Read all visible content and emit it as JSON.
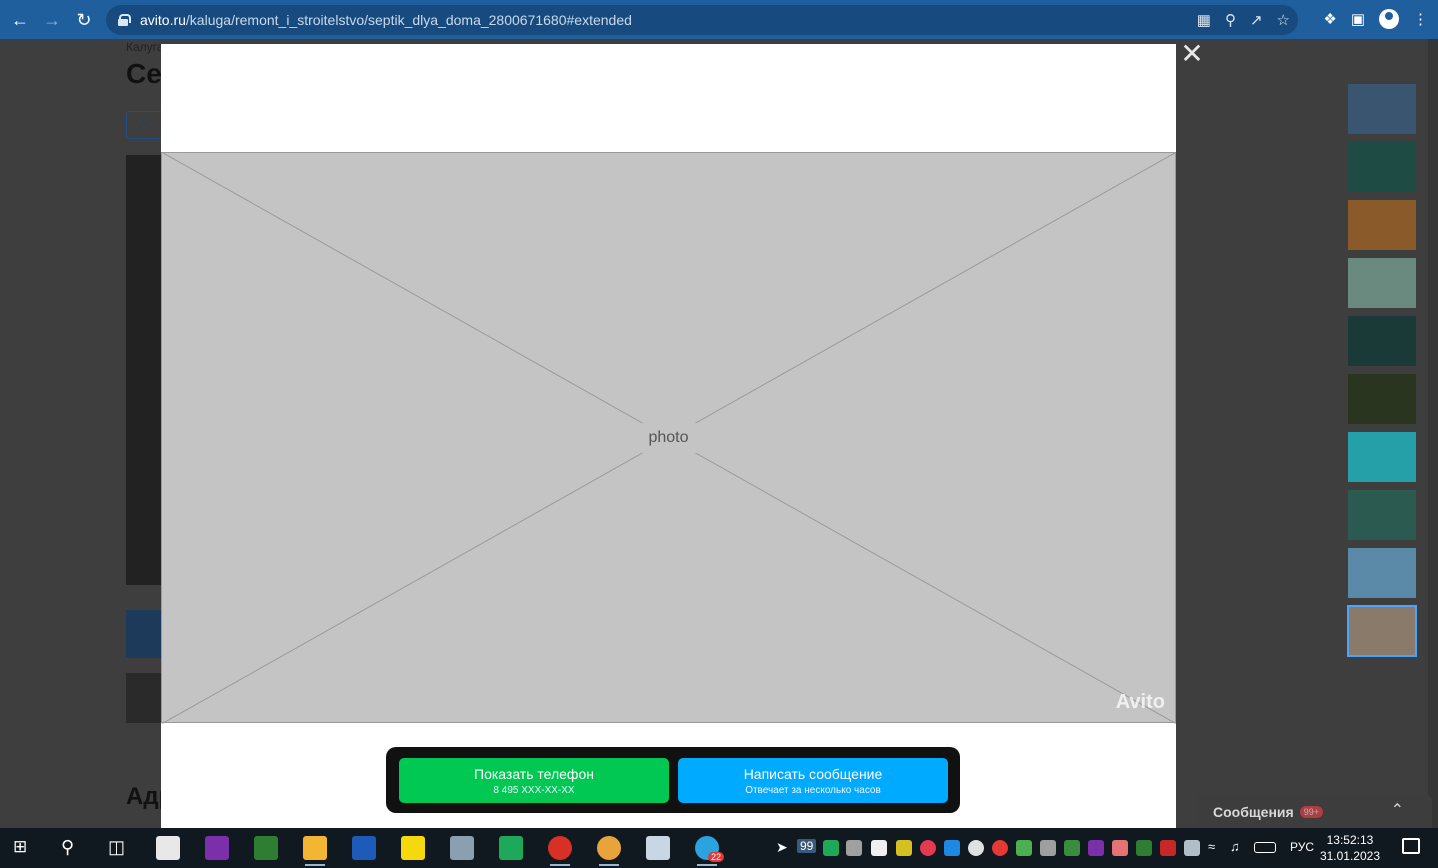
{
  "browser": {
    "url_host": "avito.ru",
    "url_path": "/kaluga/remont_i_stroitelstvo/septik_dlya_doma_2800671680#extended"
  },
  "background_page": {
    "breadcrumb": "Калуга",
    "title_fragment": "Се",
    "favorite_label": "",
    "address_heading": "Адр"
  },
  "gallery": {
    "watermark": "Avito",
    "thumbnail_count": 10,
    "active_thumbnail_index": 9,
    "thumbnail_colors": [
      "#3a5570",
      "#1f4b45",
      "#8a5a2a",
      "#6a8a80",
      "#1a3a38",
      "#2a3520",
      "#25a0a8",
      "#2a5a50",
      "#5a8aa8",
      "#8a7a6a"
    ]
  },
  "actions": {
    "phone_button": {
      "label": "Показать телефон",
      "sublabel": "8 495 XXX-XX-XX"
    },
    "message_button": {
      "label": "Написать сообщение",
      "sublabel": "Отвечает за несколько часов"
    }
  },
  "messages_widget": {
    "label": "Сообщения",
    "badge": "99+"
  },
  "taskbar": {
    "telegram_badge": "22",
    "tray_count": "99",
    "language": "РУС",
    "time": "13:52:13",
    "date": "31.01.2023"
  },
  "colors": {
    "chrome_blue": "#1f5f9e",
    "phone_green": "#00c853",
    "message_blue": "#00aaff",
    "badge_red": "#ff3d44"
  }
}
